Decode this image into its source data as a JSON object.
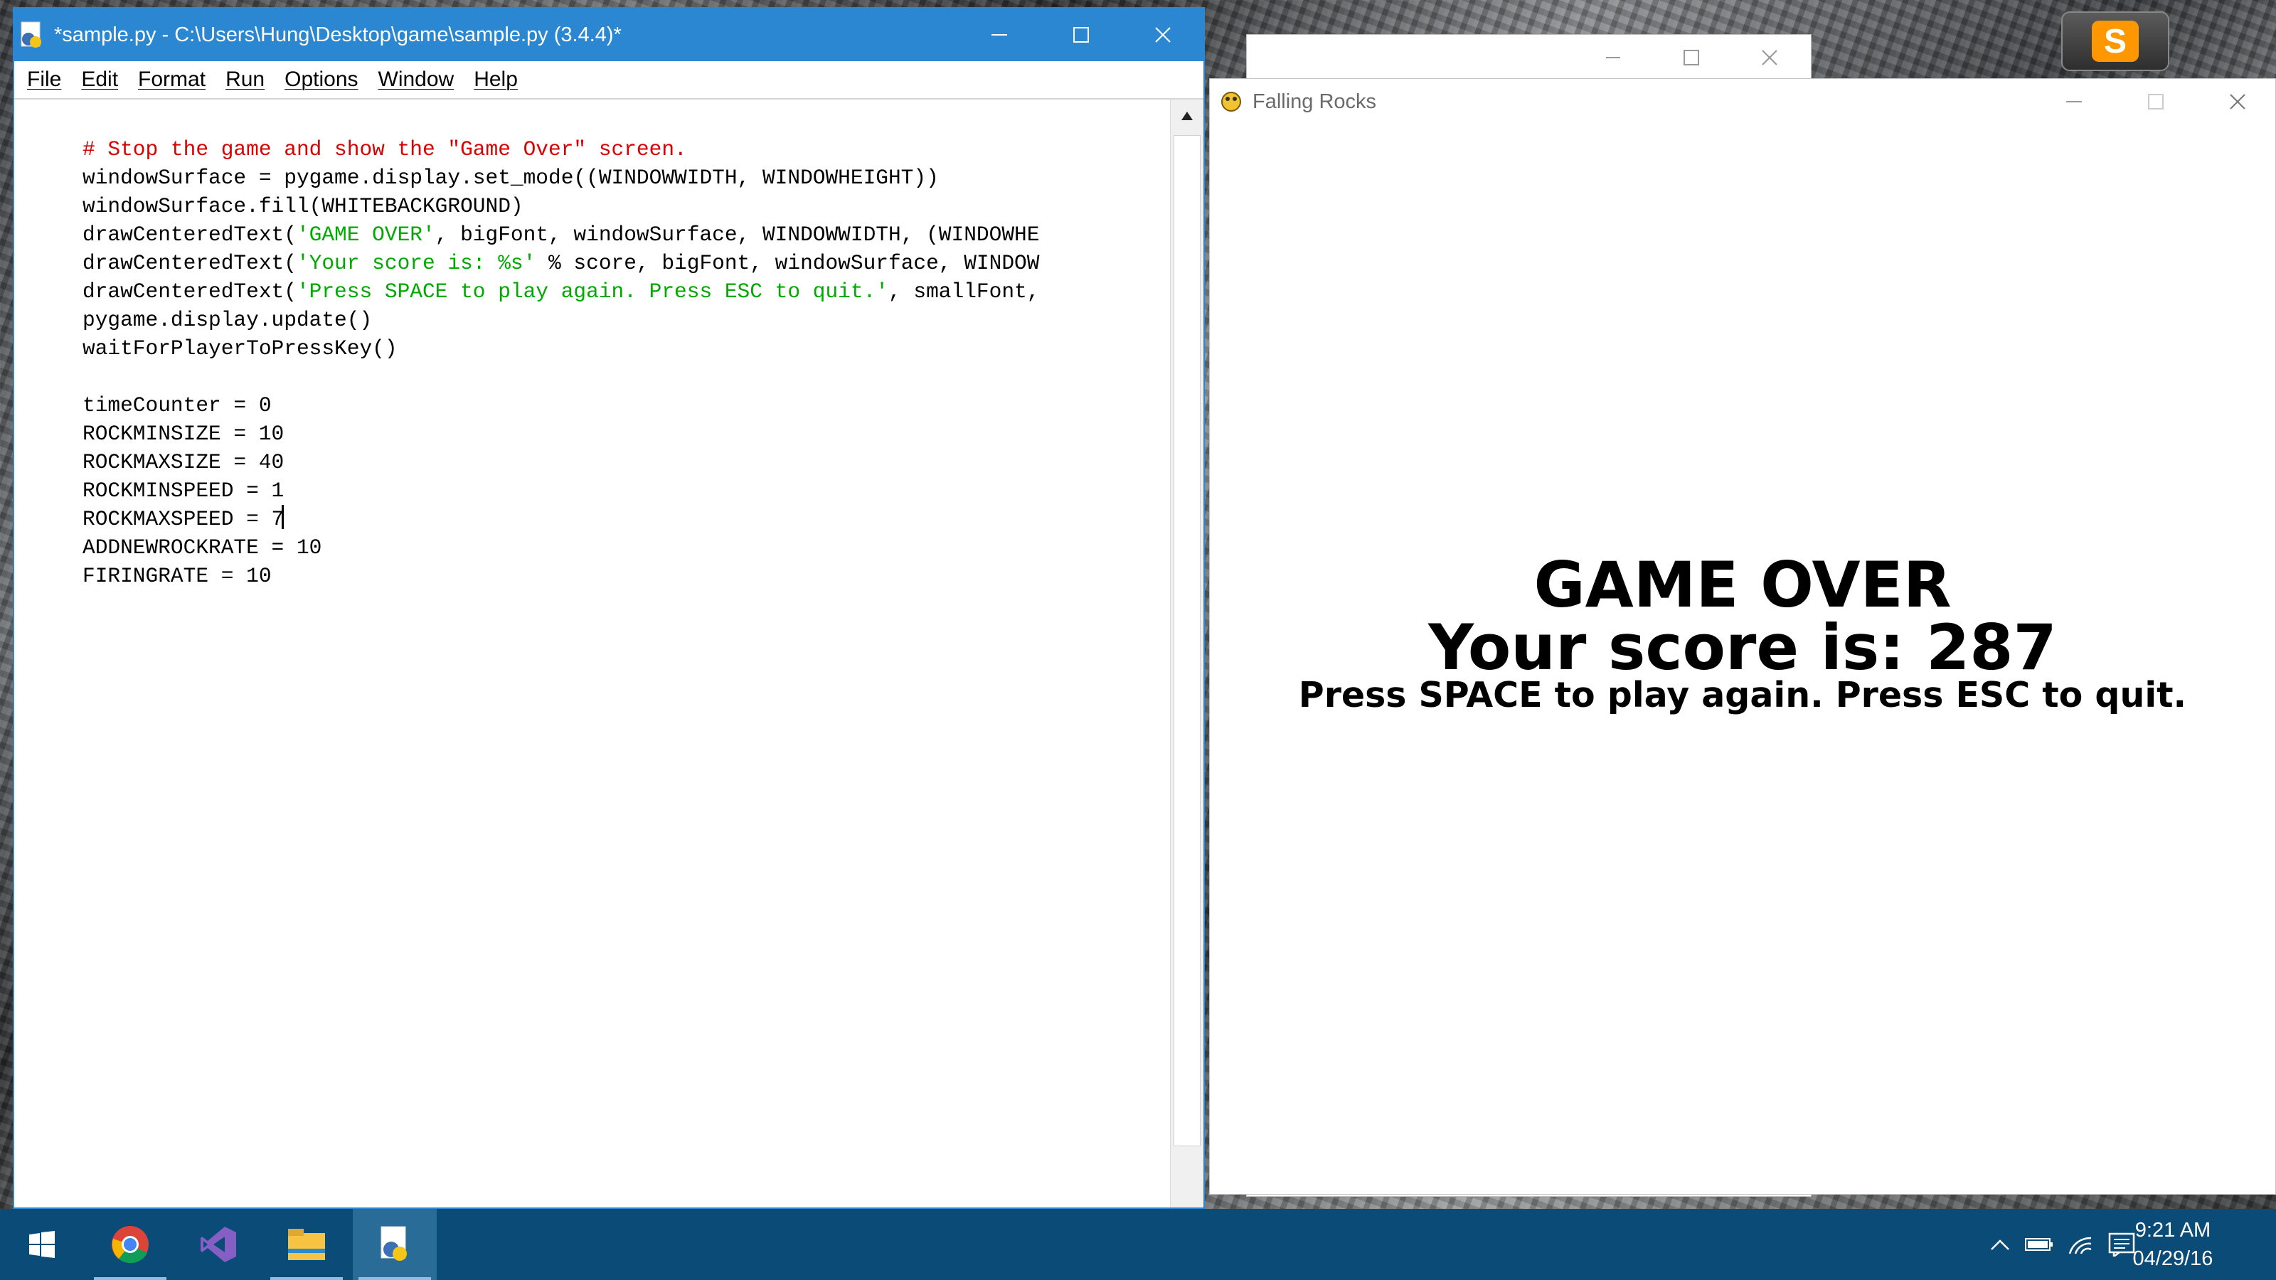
{
  "idle_window": {
    "title": "*sample.py - C:\\Users\\Hung\\Desktop\\game\\sample.py (3.4.4)*",
    "menu": [
      "File",
      "Edit",
      "Format",
      "Run",
      "Options",
      "Window",
      "Help"
    ],
    "code_lines": [
      {
        "segments": [
          {
            "text": "# Stop the game and show the \"Game Over\" screen.",
            "style": "comment"
          }
        ]
      },
      {
        "segments": [
          {
            "text": "windowSurface = pygame.display.set_mode((WINDOWWIDTH, WINDOWHEIGHT))",
            "style": "normal"
          }
        ]
      },
      {
        "segments": [
          {
            "text": "windowSurface.fill(WHITEBACKGROUND)",
            "style": "normal"
          }
        ]
      },
      {
        "segments": [
          {
            "text": "drawCenteredText(",
            "style": "normal"
          },
          {
            "text": "'GAME OVER'",
            "style": "string"
          },
          {
            "text": ", bigFont, windowSurface, WINDOWWIDTH, (WINDOWHE",
            "style": "normal"
          }
        ]
      },
      {
        "segments": [
          {
            "text": "drawCenteredText(",
            "style": "normal"
          },
          {
            "text": "'Your score is: %s'",
            "style": "string"
          },
          {
            "text": " % score, bigFont, windowSurface, WINDOW",
            "style": "normal"
          }
        ]
      },
      {
        "segments": [
          {
            "text": "drawCenteredText(",
            "style": "normal"
          },
          {
            "text": "'Press SPACE to play again. Press ESC to quit.'",
            "style": "string"
          },
          {
            "text": ", smallFont,",
            "style": "normal"
          }
        ]
      },
      {
        "segments": [
          {
            "text": "pygame.display.update()",
            "style": "normal"
          }
        ]
      },
      {
        "segments": [
          {
            "text": "waitForPlayerToPressKey()",
            "style": "normal"
          }
        ]
      },
      {
        "segments": [
          {
            "text": "",
            "style": "normal"
          }
        ]
      },
      {
        "segments": [
          {
            "text": "timeCounter = 0",
            "style": "normal"
          }
        ]
      },
      {
        "segments": [
          {
            "text": "ROCKMINSIZE = 10",
            "style": "normal"
          }
        ]
      },
      {
        "segments": [
          {
            "text": "ROCKMAXSIZE = 40",
            "style": "normal"
          }
        ]
      },
      {
        "segments": [
          {
            "text": "ROCKMINSPEED = 1",
            "style": "normal"
          }
        ]
      },
      {
        "segments": [
          {
            "text": "ROCKMAXSPEED = 7",
            "style": "normal"
          }
        ],
        "cursor": true
      },
      {
        "segments": [
          {
            "text": "ADDNEWROCKRATE = 10",
            "style": "normal"
          }
        ]
      },
      {
        "segments": [
          {
            "text": "FIRINGRATE = 10",
            "style": "normal"
          }
        ]
      }
    ]
  },
  "game_window": {
    "title": "Falling Rocks",
    "line1": "GAME OVER",
    "line2": "Your score is: 287",
    "line3": "Press SPACE to play again. Press ESC to quit."
  },
  "taskbar": {
    "time": "9:21 AM",
    "date": "04/29/16",
    "apps": [
      "windows-start",
      "chrome",
      "visual-studio",
      "file-explorer",
      "python-idle"
    ]
  },
  "colors": {
    "idle_titlebar": "#2b87d1",
    "comment": "#dd0000",
    "string": "#00aa00",
    "taskbar": "#0b4b78"
  }
}
